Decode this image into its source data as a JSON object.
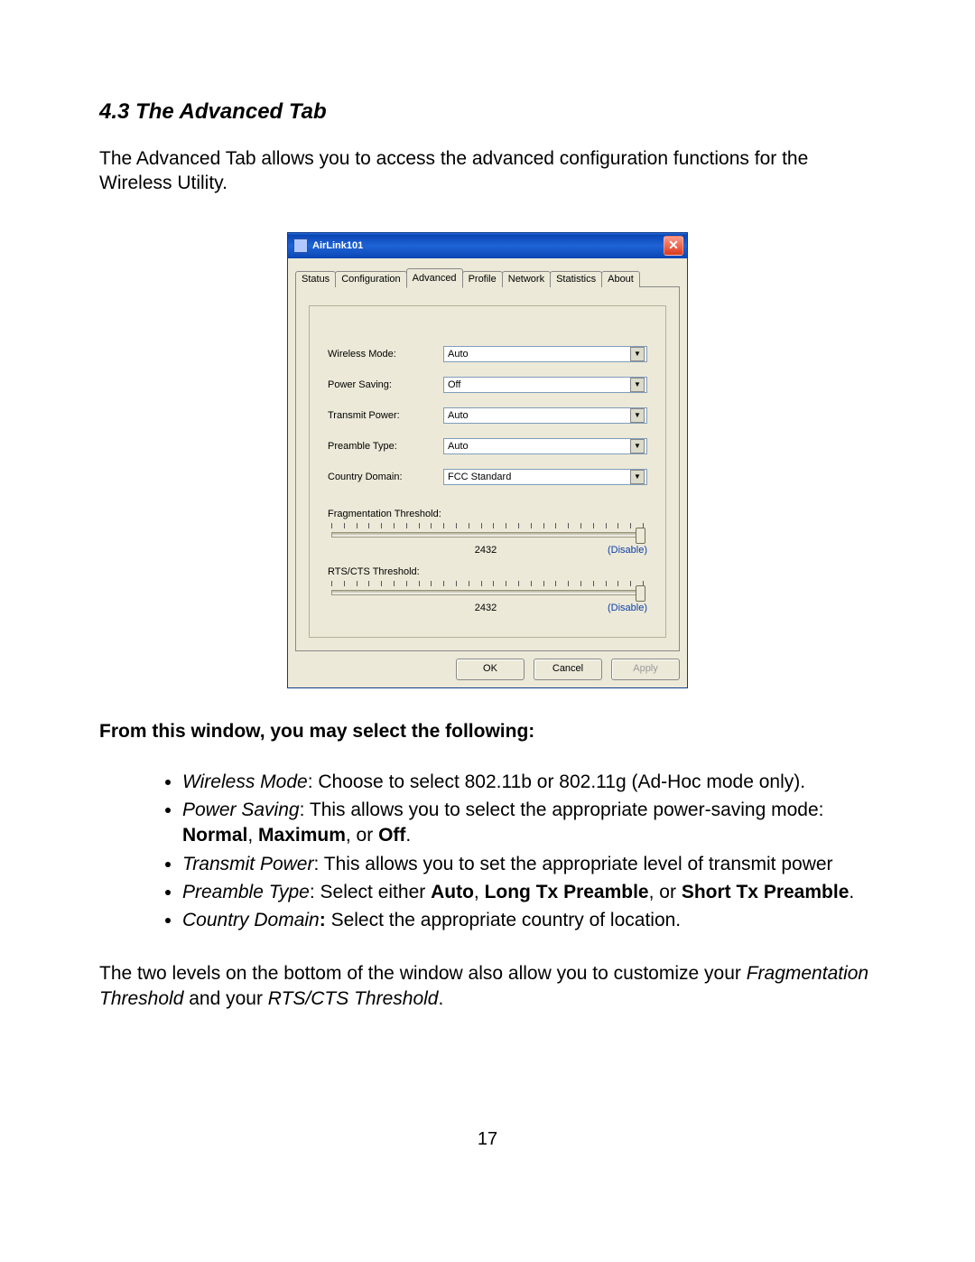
{
  "section": {
    "number": "4.3",
    "title": "The Advanced Tab",
    "intro": "The Advanced Tab allows you to access the advanced configuration functions for the Wireless Utility."
  },
  "window": {
    "title": "AirLink101",
    "tabs": [
      "Status",
      "Configuration",
      "Advanced",
      "Profile",
      "Network",
      "Statistics",
      "About"
    ],
    "active_tab": "Advanced",
    "fields": {
      "wireless_mode": {
        "label": "Wireless Mode:",
        "value": "Auto"
      },
      "power_saving": {
        "label": "Power Saving:",
        "value": "Off"
      },
      "transmit_power": {
        "label": "Transmit Power:",
        "value": "Auto"
      },
      "preamble_type": {
        "label": "Preamble Type:",
        "value": "Auto"
      },
      "country_domain": {
        "label": "Country Domain:",
        "value": "FCC Standard"
      }
    },
    "sliders": {
      "frag": {
        "label": "Fragmentation Threshold:",
        "value": "2432",
        "link": "(Disable)"
      },
      "rts": {
        "label": "RTS/CTS Threshold:",
        "value": "2432",
        "link": "(Disable)"
      }
    },
    "buttons": {
      "ok": "OK",
      "cancel": "Cancel",
      "apply": "Apply"
    }
  },
  "body": {
    "subhead": "From this window, you may select the following:",
    "bullets": {
      "wm": {
        "term": "Wireless Mode",
        "rest": ": Choose to select  802.11b or 802.11g (Ad-Hoc mode only)."
      },
      "ps": {
        "term": "Power Saving",
        "rest": ": This allows you to select the appropriate power-saving mode: ",
        "bold": "Normal",
        "sep1": ", ",
        "bold2": "Maximum",
        "sep2": ", or ",
        "bold3": "Off",
        "end": "."
      },
      "tp": {
        "term": "Transmit Power",
        "rest": ": This allows you to set the appropriate level of transmit power"
      },
      "pt": {
        "term": "Preamble Type",
        "rest": ": Select either ",
        "b1": "Auto",
        "s1": ",  ",
        "b2": "Long Tx Preamble",
        "s2": ", or ",
        "b3": "Short Tx Preamble",
        "end": "."
      },
      "cd": {
        "term": "Country Domain",
        "colon": ":",
        "rest": " Select the appropriate country of location."
      }
    },
    "para_lead": "The two levels on the bottom of the window also allow you to customize your ",
    "para_i1": "Fragmentation Threshold",
    "para_mid": " and your ",
    "para_i2": "RTS/CTS Threshold",
    "para_end": "."
  },
  "page_number": "17"
}
